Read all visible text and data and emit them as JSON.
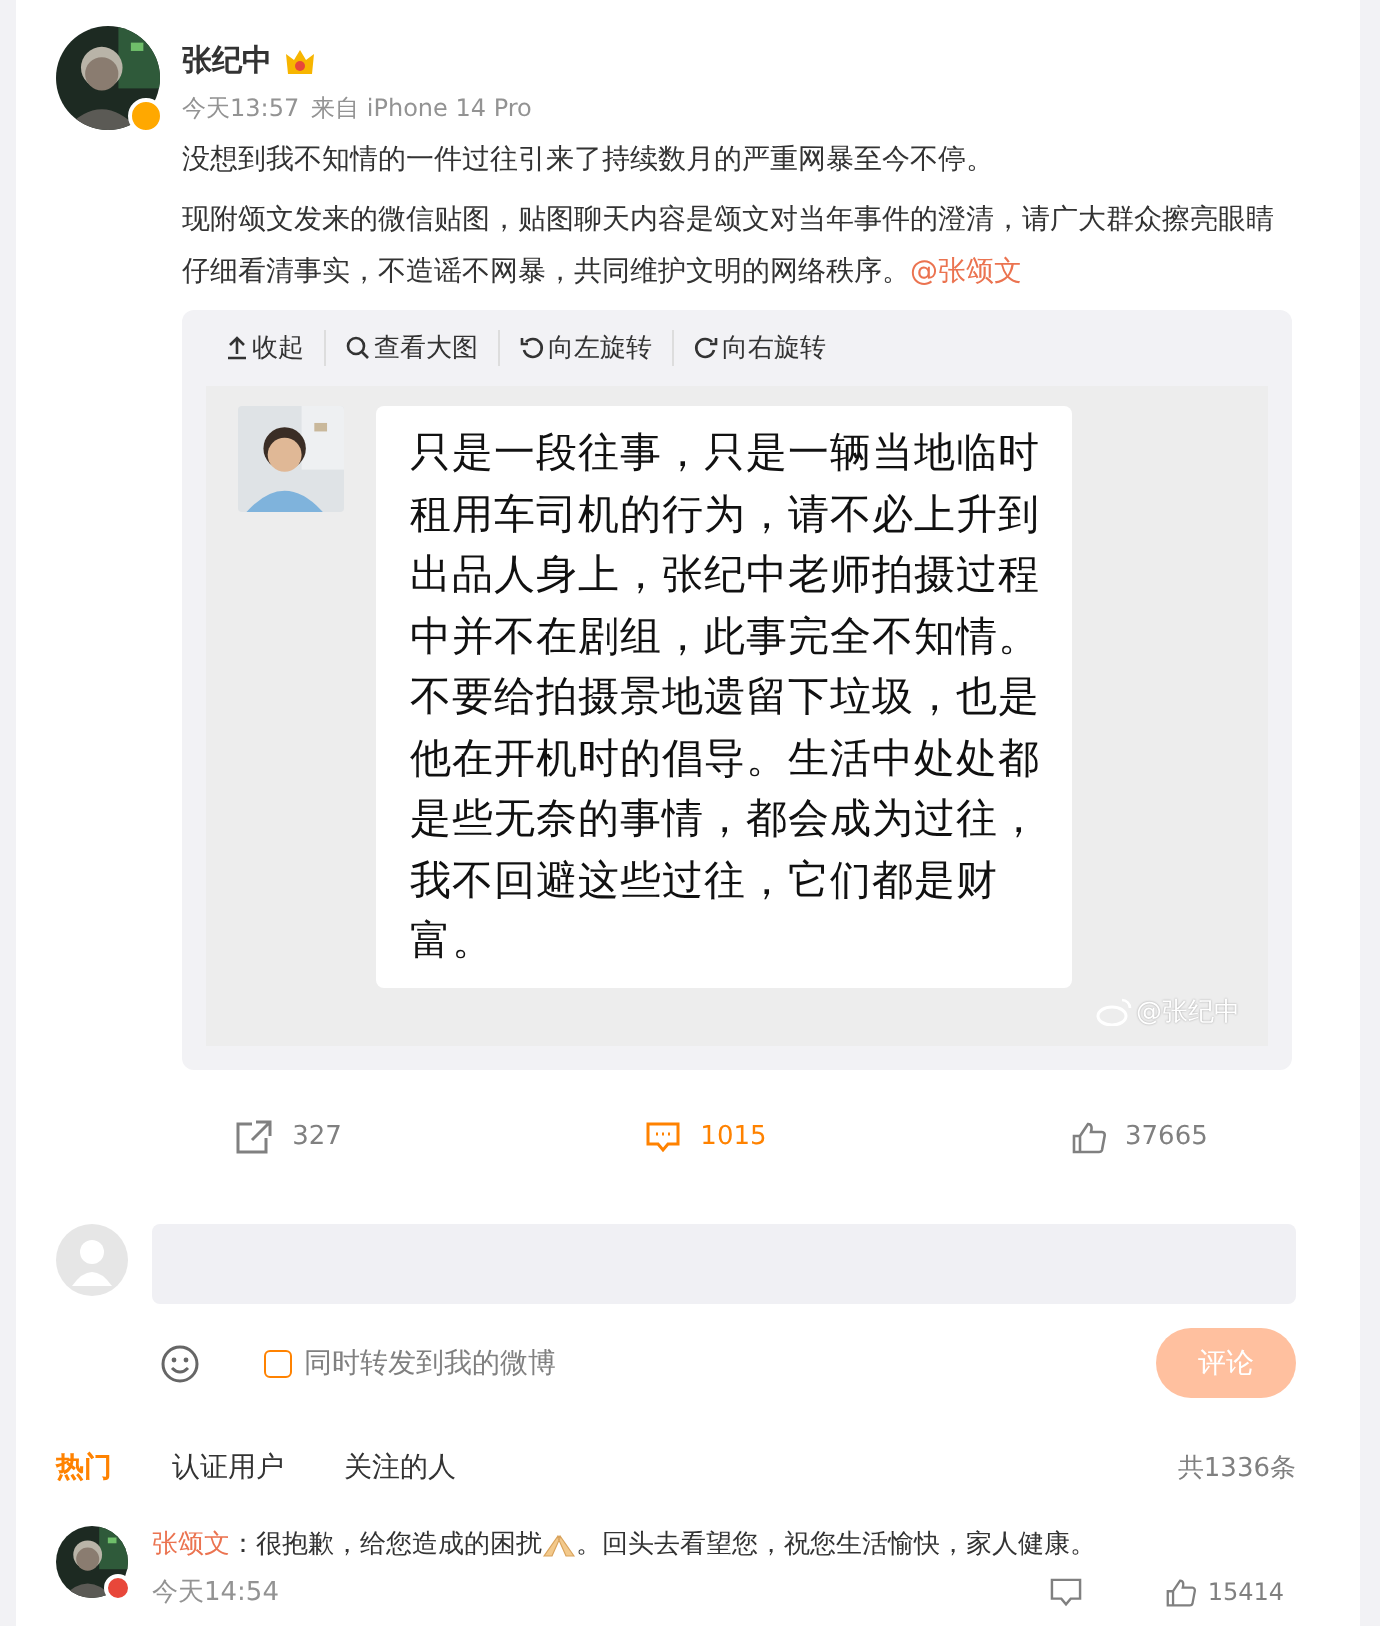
{
  "post": {
    "author": "张纪中",
    "time": "今天13:57",
    "source": "来自 iPhone 14 Pro",
    "paragraphs": [
      "没想到我不知情的一件过往引来了持续数月的严重网暴至今不停。",
      "现附颂文发来的微信贴图，贴图聊天内容是颂文对当年事件的澄清，请广大群众擦亮眼睛仔细看清事实，不造谣不网暴，共同维护文明的网络秩序。"
    ],
    "mention": "@张颂文"
  },
  "image_toolbar": [
    {
      "kind": "collapse",
      "label": "收起"
    },
    {
      "kind": "zoom",
      "label": "查看大图"
    },
    {
      "kind": "rotate_left",
      "label": "向左旋转"
    },
    {
      "kind": "rotate_right",
      "label": "向右旋转"
    }
  ],
  "chat_image": {
    "lines": [
      "只是一段往事，只是一辆当地临时",
      "租用车司机的行为，请不必上升到",
      "出品人身上，张纪中老师拍摄过程",
      "中并不在剧组，此事完全不知情。",
      "不要给拍摄景地遗留下垃圾，也是",
      "他在开机时的倡导。生活中处处都",
      "是些无奈的事情，都会成为过往，",
      "我不回避这些过往，它们都是财",
      "富。"
    ],
    "watermark": "@张纪中"
  },
  "actions": [
    {
      "kind": "share",
      "count": "327",
      "selected": false
    },
    {
      "kind": "comment",
      "count": "1015",
      "selected": true
    },
    {
      "kind": "like",
      "count": "37665",
      "selected": false
    }
  ],
  "composer": {
    "repost_label": "同时转发到我的微博",
    "repost_checked": false,
    "submit": "评论"
  },
  "comment_tabs": [
    {
      "label": "热门",
      "selected": true
    },
    {
      "label": "认证用户",
      "selected": false
    },
    {
      "label": "关注的人",
      "selected": false
    }
  ],
  "comment_total": "共1336条",
  "comments": [
    {
      "author": "张颂文",
      "text_before": "：很抱歉，给您造成的困扰",
      "text_after": "。回头去看望您，祝您生活愉快，家人健康。",
      "time": "今天14:54",
      "likes": "15414"
    }
  ]
}
